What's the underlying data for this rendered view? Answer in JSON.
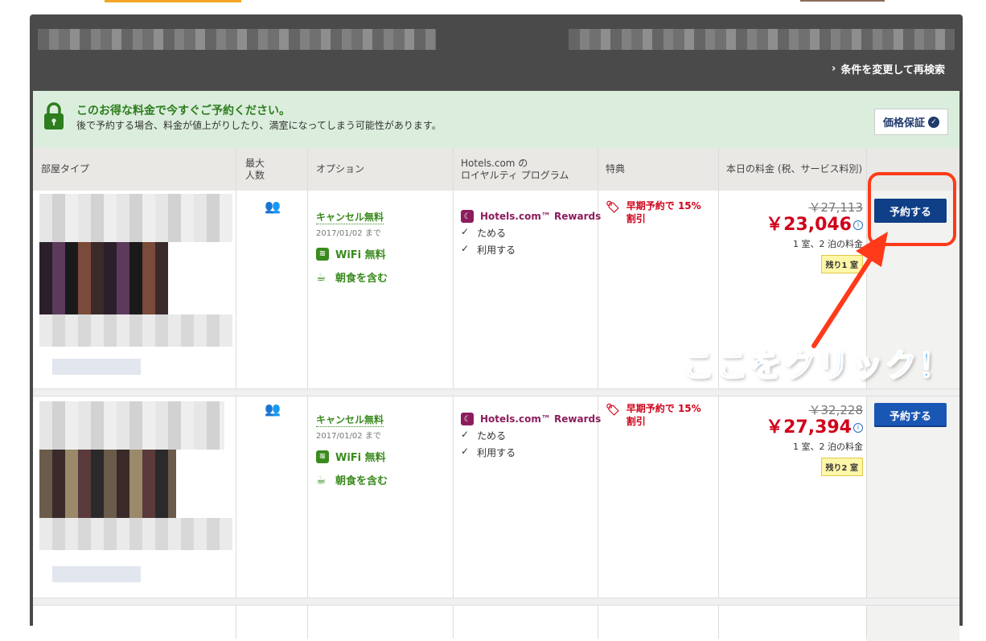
{
  "header": {
    "requery_label": "条件を変更して再検索"
  },
  "promo": {
    "title": "このお得な料金で今すぐご予約ください。",
    "subtitle": "後で予約する場合、料金が値上がりしたり、満室になってしまう可能性があります。",
    "guarantee_label": "価格保証"
  },
  "table": {
    "columns": {
      "room_type": "部屋タイプ",
      "max_persons_line1": "最大",
      "max_persons_line2": "人数",
      "options": "オプション",
      "loyalty_line1": "Hotels.com の",
      "loyalty_line2": "ロイヤルティ プログラム",
      "perks": "特典",
      "price": "本日の料金 (税、サービス料別)"
    }
  },
  "rows": [
    {
      "cancel": "キャンセル無料",
      "until": "2017/01/02 まで",
      "wifi": "WiFi 無料",
      "breakfast": "朝食を含む",
      "loyalty_name": "Hotels.com™ Rewards",
      "loyalty_earn": "ためる",
      "loyalty_use": "利用する",
      "perk_line1": "早期予約で 15%",
      "perk_line2": "割引",
      "old_price": "￥27,113",
      "new_price": "￥23,046",
      "per": "1 室、2 泊の料金",
      "remaining": "残り1 室",
      "book_label": "予約する"
    },
    {
      "cancel": "キャンセル無料",
      "until": "2017/01/02 まで",
      "wifi": "WiFi 無料",
      "breakfast": "朝食を含む",
      "loyalty_name": "Hotels.com™ Rewards",
      "loyalty_earn": "ためる",
      "loyalty_use": "利用する",
      "perk_line1": "早期予約で 15%",
      "perk_line2": "割引",
      "old_price": "￥32,228",
      "new_price": "￥27,394",
      "per": "1 室、2 泊の料金",
      "remaining": "残り2 室",
      "book_label": "予約する"
    }
  ],
  "annotation": {
    "text": "ここをクリック！"
  },
  "colors": {
    "green": "#3a8a1e",
    "red": "#d0021b",
    "rewards": "#8c1d5d",
    "button": "#1a57b4",
    "callout": "#ff3a1a"
  }
}
